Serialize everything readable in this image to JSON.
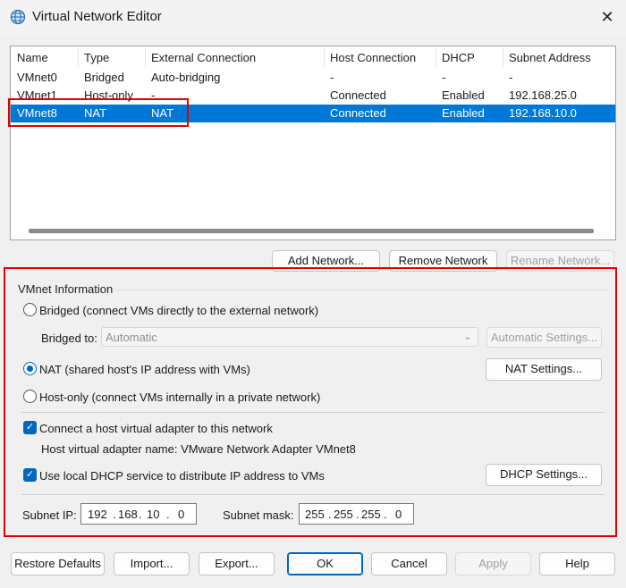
{
  "window": {
    "title": "Virtual Network Editor",
    "close_glyph": "✕",
    "icon": "globe-icon"
  },
  "table": {
    "headers": [
      "Name",
      "Type",
      "External Connection",
      "Host Connection",
      "DHCP",
      "Subnet Address"
    ],
    "rows": [
      [
        "VMnet0",
        "Bridged",
        "Auto-bridging",
        "-",
        "-",
        "-"
      ],
      [
        "VMnet1",
        "Host-only",
        "-",
        "Connected",
        "Enabled",
        "192.168.25.0"
      ],
      [
        "VMnet8",
        "NAT",
        "NAT",
        "Connected",
        "Enabled",
        "192.168.10.0"
      ]
    ],
    "selected_index": 2
  },
  "network_buttons": {
    "add": "Add Network...",
    "remove": "Remove Network",
    "rename": "Rename Network..."
  },
  "vmnet_info": {
    "title": "VMnet Information",
    "bridged_label": "Bridged (connect VMs directly to the external network)",
    "bridged_to_label": "Bridged to:",
    "bridged_to_value": "Automatic",
    "automatic_settings": "Automatic Settings...",
    "nat_label": "NAT (shared host's IP address with VMs)",
    "nat_settings": "NAT Settings...",
    "hostonly_label": "Host-only (connect VMs internally in a private network)",
    "connect_adapter_label": "Connect a host virtual adapter to this network",
    "adapter_name_text": "Host virtual adapter name: VMware Network Adapter VMnet8",
    "dhcp_label": "Use local DHCP service to distribute IP address to VMs",
    "dhcp_settings": "DHCP Settings...",
    "subnet_ip_label": "Subnet IP:",
    "subnet_ip": [
      "192",
      "168",
      "10",
      "0"
    ],
    "subnet_mask_label": "Subnet mask:",
    "subnet_mask": [
      "255",
      "255",
      "255",
      "0"
    ],
    "selected_mode": "NAT"
  },
  "footer": {
    "restore": "Restore Defaults",
    "import": "Import...",
    "export": "Export...",
    "ok": "OK",
    "cancel": "Cancel",
    "apply": "Apply",
    "help": "Help"
  },
  "colors": {
    "accent": "#0078d7",
    "highlight_box": "#e30000"
  }
}
